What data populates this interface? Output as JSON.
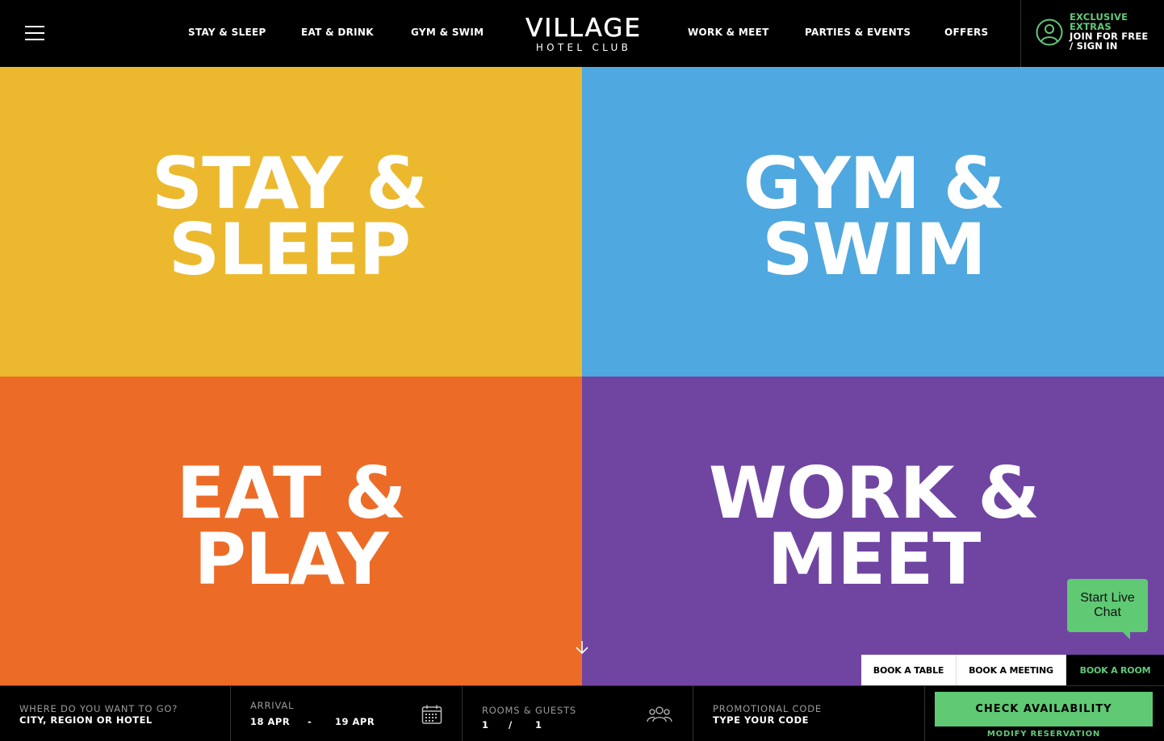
{
  "header": {
    "menu_icon": "hamburger-icon",
    "nav_left": [
      "STAY & SLEEP",
      "EAT & DRINK",
      "GYM & SWIM"
    ],
    "nav_right": [
      "WORK & MEET",
      "PARTIES & EVENTS",
      "OFFERS"
    ],
    "logo_main": "VILLAGE",
    "logo_sub": "HOTEL CLUB",
    "account": {
      "icon": "user-circle-icon",
      "line1": "EXCLUSIVE",
      "line2": "EXTRAS",
      "line3": "JOIN FOR FREE",
      "line4": "/ SIGN IN"
    }
  },
  "tiles": [
    {
      "title": "STAY &\nSLEEP",
      "color": "#ecb92e"
    },
    {
      "title": "GYM &\nSWIM",
      "color": "#4fa8df"
    },
    {
      "title": "EAT &\nPLAY",
      "color": "#ec6c27"
    },
    {
      "title": "WORK &\nMEET",
      "color": "#7045a1"
    }
  ],
  "scroll_icon": "arrow-down-icon",
  "chat": {
    "line1": "Start Live",
    "line2": "Chat"
  },
  "booking_tabs": [
    "BOOK A TABLE",
    "BOOK A MEETING",
    "BOOK A ROOM"
  ],
  "booking": {
    "where_label": "WHERE DO YOU WANT TO GO?",
    "where_value": "CITY, REGION OR HOTEL",
    "arrival_label": "ARRIVAL",
    "arrival_date": "18 APR",
    "date_sep": "-",
    "departure_date": "19 APR",
    "calendar_icon": "calendar-icon",
    "rooms_label": "ROOMS & GUESTS",
    "rooms_value": "1",
    "rooms_sep": "/",
    "guests_value": "1",
    "guests_icon": "people-icon",
    "promo_label": "PROMOTIONAL CODE",
    "promo_value": "TYPE YOUR CODE",
    "check_button": "CHECK AVAILABILITY",
    "modify_link": "MODIFY RESERVATION"
  },
  "colors": {
    "accent_green": "#62c97a",
    "button_green": "#5fc974"
  }
}
